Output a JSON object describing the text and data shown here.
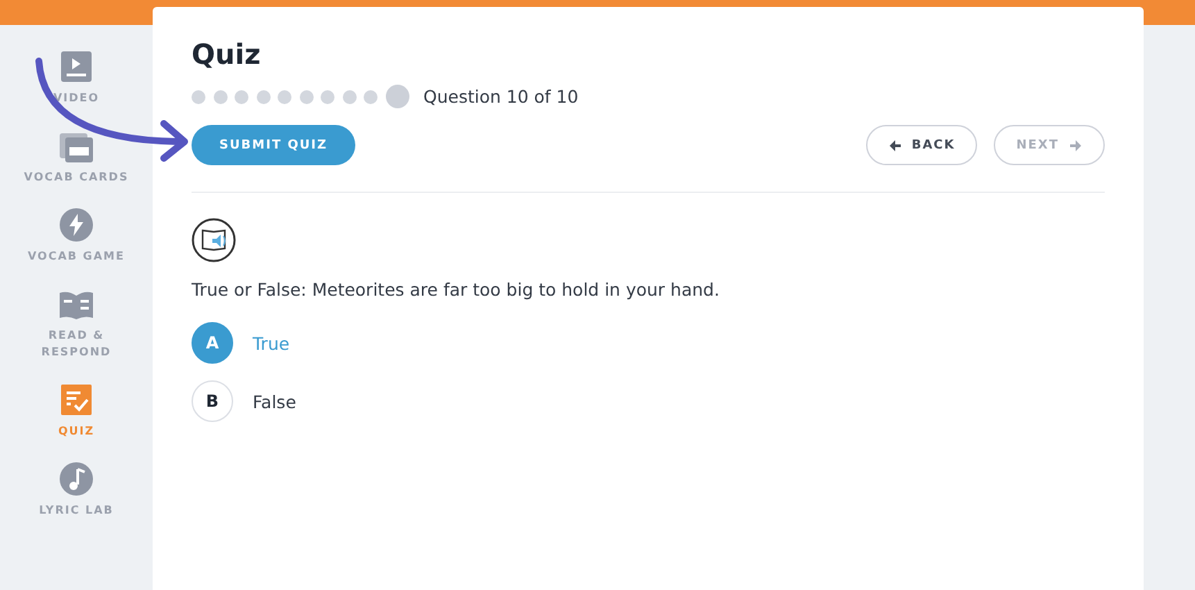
{
  "sidebar": {
    "items": [
      {
        "kind": "video",
        "label": "VIDEO",
        "selected": false
      },
      {
        "kind": "cards",
        "label": "VOCAB CARDS",
        "selected": false
      },
      {
        "kind": "game",
        "label": "VOCAB GAME",
        "selected": false
      },
      {
        "kind": "read",
        "label": "READ & RESPOND",
        "selected": false
      },
      {
        "kind": "quiz",
        "label": "QUIZ",
        "selected": true
      },
      {
        "kind": "lyric",
        "label": "LYRIC LAB",
        "selected": false
      }
    ]
  },
  "quiz": {
    "title": "Quiz",
    "progress": [
      {
        "current": false
      },
      {
        "current": false
      },
      {
        "current": false
      },
      {
        "current": false
      },
      {
        "current": false
      },
      {
        "current": false
      },
      {
        "current": false
      },
      {
        "current": false
      },
      {
        "current": false
      },
      {
        "current": true
      }
    ],
    "progress_label": "Question 10 of 10",
    "submit": "SUBMIT QUIZ",
    "back": {
      "label": "BACK",
      "disabled": false
    },
    "next": {
      "label": "NEXT",
      "disabled": true
    },
    "question": "True or False: Meteorites are far too big to hold in your hand.",
    "options": [
      {
        "letter": "A",
        "text": "True",
        "selected": true
      },
      {
        "letter": "B",
        "text": "False",
        "selected": false
      }
    ]
  }
}
